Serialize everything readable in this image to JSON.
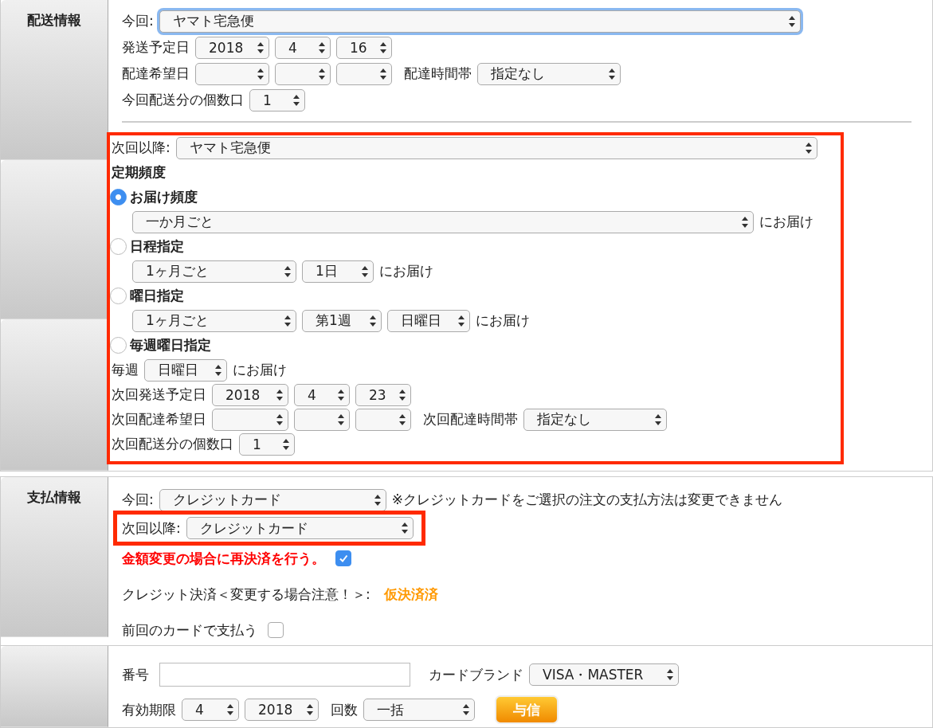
{
  "shipping": {
    "header": "配送情報",
    "current": {
      "label": "今回:",
      "value": "ヤマト宅急便",
      "focused": true
    },
    "ship_date": {
      "label": "発送予定日",
      "selects": [
        {
          "value": "2018"
        },
        {
          "value": "4"
        },
        {
          "value": "16"
        }
      ]
    },
    "delivery_date": {
      "label": "配達希望日",
      "time_label": "配達時間帯",
      "time_value": "指定なし"
    },
    "quantity": {
      "label": "今回配送分の個数口",
      "value": "1"
    },
    "next": {
      "highlighted": true,
      "carrier": {
        "label": "次回以降:",
        "value": "ヤマト宅急便"
      },
      "frequency_title": "定期頻度",
      "options": [
        {
          "kind": "interval",
          "label": "お届け頻度",
          "selected": true,
          "selects": [
            "一か月ごと"
          ],
          "suffix": "にお届け"
        },
        {
          "kind": "date",
          "label": "日程指定",
          "selected": false,
          "selects": [
            "1ヶ月ごと",
            "1日"
          ],
          "suffix": "にお届け"
        },
        {
          "kind": "weekday",
          "label": "曜日指定",
          "selected": false,
          "selects": [
            "1ヶ月ごと",
            "第1週",
            "日曜日"
          ],
          "suffix": "にお届け"
        },
        {
          "kind": "weekly",
          "label": "毎週曜日指定",
          "selected": false,
          "prefix": "毎週",
          "selects": [
            "日曜日"
          ],
          "suffix": "にお届け"
        }
      ],
      "ship_date": {
        "label": "次回発送予定日",
        "selects": [
          {
            "value": "2018"
          },
          {
            "value": "4"
          },
          {
            "value": "23"
          }
        ]
      },
      "delivery_date": {
        "label": "次回配達希望日",
        "time_label": "次回配達時間帯",
        "time_value": "指定なし"
      },
      "quantity": {
        "label": "次回配送分の個数口",
        "value": "1"
      }
    }
  },
  "payment": {
    "header": "支払情報",
    "current": {
      "label": "今回:",
      "value": "クレジットカード",
      "note": "※クレジットカードをご選択の注文の支払方法は変更できません"
    },
    "next": {
      "label": "次回以降:",
      "value": "クレジットカード",
      "highlighted": true
    },
    "resettle": {
      "label": "金額変更の場合に再決済を行う。",
      "checked": true
    },
    "credit_status": {
      "label": "クレジット決済＜変更する場合注意！＞:",
      "value": "仮決済済"
    },
    "previous_card": {
      "label": "前回のカードで支払う",
      "checked": false
    }
  },
  "card": {
    "number_label": "番号",
    "brand_label": "カードブランド",
    "brand_value": "VISA・MASTER",
    "expiry_label": "有効期限",
    "expiry_month": "4",
    "expiry_year": "2018",
    "installments_label": "回数",
    "installments_value": "一括",
    "authorize_button": "与信"
  }
}
